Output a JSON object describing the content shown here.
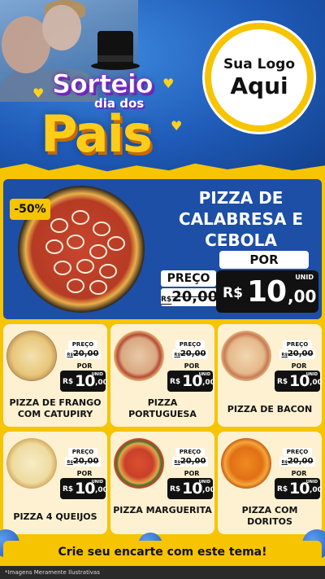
{
  "header": {
    "title_line1": "Sorteio",
    "title_line2": "dia dos",
    "title_line3": "Pais",
    "logo_line1": "Sua Logo",
    "logo_line2": "Aqui"
  },
  "featured": {
    "discount": "-50%",
    "name": "PIZZA DE CALABRESA E CEBOLA",
    "preco_label": "PREÇO",
    "old_currency": "R$",
    "old_price": "20,00",
    "por_label": "POR",
    "unid": "UNID",
    "currency": "R$",
    "price_int": "10",
    "price_dec": ",00"
  },
  "products": [
    {
      "name": "PIZZA DE FRANGO COM CATUPIRY",
      "preco_label": "PREÇO",
      "old_price": "20,00",
      "por_label": "POR",
      "unid": "UNID",
      "currency": "R$",
      "price_int": "10",
      "price_dec": ",00"
    },
    {
      "name": "PIZZA PORTUGUESA",
      "preco_label": "PREÇO",
      "old_price": "20,00",
      "por_label": "POR",
      "unid": "UNID",
      "currency": "R$",
      "price_int": "10",
      "price_dec": ",00"
    },
    {
      "name": "PIZZA DE BACON",
      "preco_label": "PREÇO",
      "old_price": "20,00",
      "por_label": "POR",
      "unid": "UNID",
      "currency": "R$",
      "price_int": "10",
      "price_dec": ",00"
    },
    {
      "name": "PIZZA 4 QUEIJOS",
      "preco_label": "PREÇO",
      "old_price": "20,00",
      "por_label": "POR",
      "unid": "UNID",
      "currency": "R$",
      "price_int": "10",
      "price_dec": ",00"
    },
    {
      "name": "PIZZA MARGUERITA",
      "preco_label": "PREÇO",
      "old_price": "20,00",
      "por_label": "POR",
      "unid": "UNID",
      "currency": "R$",
      "price_int": "10",
      "price_dec": ",00"
    },
    {
      "name": "PIZZA COM DORITOS",
      "preco_label": "PREÇO",
      "old_price": "20,00",
      "por_label": "POR",
      "unid": "UNID",
      "currency": "R$",
      "price_int": "10",
      "price_dec": ",00"
    }
  ],
  "cta": "Crie seu encarte com este tema!",
  "footer": "*Imagens Meramente Ilustrativas",
  "colors": {
    "accent": "#f6c400",
    "blue": "#1c4fa5",
    "card": "#fdf1d2",
    "dark": "#111111"
  }
}
